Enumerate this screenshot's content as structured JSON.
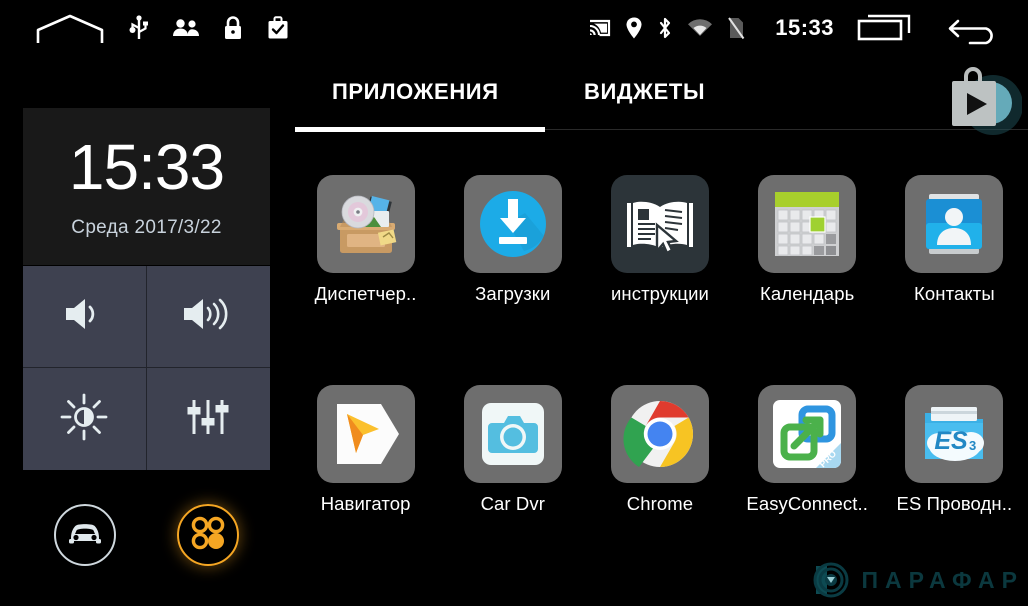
{
  "statusbar": {
    "time": "15:33",
    "left_icons": [
      {
        "name": "home-icon",
        "label": "home"
      },
      {
        "name": "usb-icon",
        "label": "usb"
      },
      {
        "name": "people-icon",
        "label": "people"
      },
      {
        "name": "lock-icon",
        "label": "lock"
      },
      {
        "name": "briefcase-check-icon",
        "label": "work-profile"
      }
    ],
    "right_icons": [
      {
        "name": "cast-icon",
        "label": "cast"
      },
      {
        "name": "location-pin-icon",
        "label": "location"
      },
      {
        "name": "bluetooth-icon",
        "label": "bluetooth"
      },
      {
        "name": "wifi-icon",
        "label": "wifi"
      },
      {
        "name": "sim-card-off-icon",
        "label": "no-sim"
      }
    ],
    "nav": [
      {
        "name": "recents-button",
        "label": "recents"
      },
      {
        "name": "back-button",
        "label": "back"
      }
    ]
  },
  "sidebar": {
    "clock": {
      "time": "15:33",
      "date": "Среда 2017/3/22"
    },
    "controls": [
      {
        "name": "volume-down-button",
        "icon": "volume-low-icon",
        "label": "Volume down"
      },
      {
        "name": "volume-up-button",
        "icon": "volume-high-icon",
        "label": "Volume up"
      },
      {
        "name": "brightness-button",
        "icon": "brightness-icon",
        "label": "Brightness"
      },
      {
        "name": "equalizer-button",
        "icon": "equalizer-icon",
        "label": "Equalizer"
      }
    ],
    "bottom_buttons": [
      {
        "name": "car-button",
        "icon": "car-icon",
        "label": "Car",
        "color": "#cfd8de",
        "active": false
      },
      {
        "name": "apps-button",
        "icon": "apps-grid-icon",
        "label": "Apps",
        "color": "#f5a623",
        "active": true
      }
    ]
  },
  "main": {
    "tabs": [
      {
        "label": "ПРИЛОЖЕНИЯ",
        "active": true
      },
      {
        "label": "ВИДЖЕТЫ",
        "active": false
      }
    ],
    "store_button": {
      "name": "play-store-button",
      "icon": "shopping-bag-play-icon"
    },
    "apps": [
      {
        "label": "Диспетчер..",
        "icon": "file-manager-box-icon"
      },
      {
        "label": "Загрузки",
        "icon": "downloads-icon"
      },
      {
        "label": "инструкции",
        "icon": "manual-book-icon"
      },
      {
        "label": "Календарь",
        "icon": "calendar-icon"
      },
      {
        "label": "Контакты",
        "icon": "contacts-icon"
      },
      {
        "label": "Навигатор",
        "icon": "navigator-arrow-icon"
      },
      {
        "label": "Car Dvr",
        "icon": "camera-icon"
      },
      {
        "label": "Chrome",
        "icon": "chrome-icon"
      },
      {
        "label": "EasyConnect..",
        "icon": "easyconnect-icon"
      },
      {
        "label": "ES Проводн..",
        "icon": "es-file-explorer-icon"
      }
    ]
  },
  "watermark": {
    "text": "ПАРАФАР",
    "color": "#0c3b42"
  },
  "colors": {
    "background": "#000000",
    "clock_panel": "#191919",
    "control_panel": "#3e4150",
    "accent_orange": "#f5a623",
    "icon_tile": "#6e6e6e",
    "text": "#ffffff"
  }
}
